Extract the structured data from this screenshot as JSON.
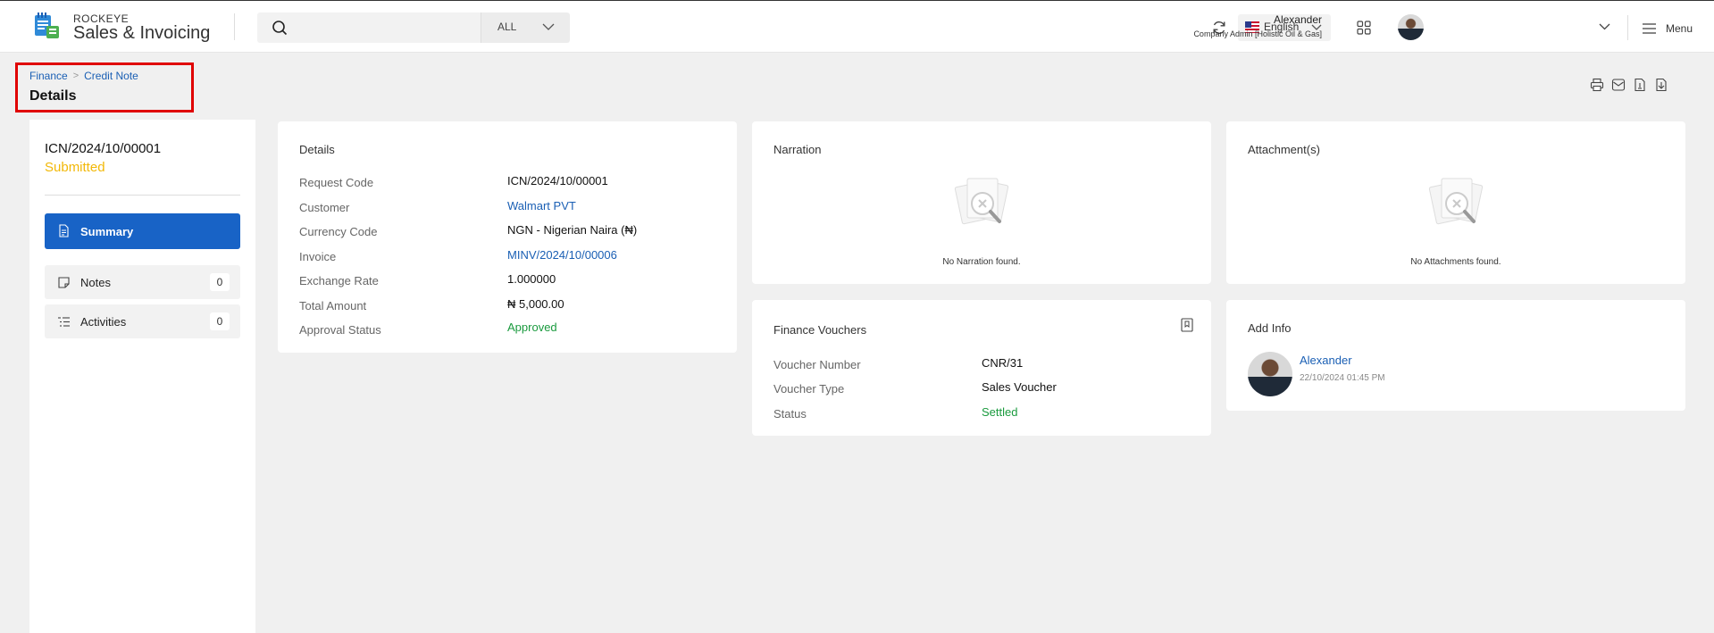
{
  "header": {
    "brand_top": "ROCKEYE",
    "brand_main": "Sales & Invoicing",
    "search_placeholder": "",
    "scope": "ALL",
    "language": "English",
    "user_name": "Alexander",
    "user_role": "Company Admin [Holistic Oil & Gas]",
    "menu_label": "Menu"
  },
  "breadcrumb": {
    "items": [
      "Finance",
      "Credit Note"
    ],
    "separator": ">"
  },
  "page_title": "Details",
  "record": {
    "code": "ICN/2024/10/00001",
    "status": "Submitted"
  },
  "nav": {
    "summary": "Summary",
    "notes": "Notes",
    "notes_count": "0",
    "activities": "Activities",
    "activities_count": "0"
  },
  "details": {
    "title": "Details",
    "labels": {
      "request_code": "Request Code",
      "customer": "Customer",
      "currency_code": "Currency Code",
      "invoice": "Invoice",
      "exchange_rate": "Exchange Rate",
      "total_amount": "Total Amount",
      "approval_status": "Approval Status"
    },
    "values": {
      "request_code": "ICN/2024/10/00001",
      "customer": "Walmart PVT",
      "currency_code": "NGN - Nigerian Naira (₦)",
      "invoice": "MINV/2024/10/00006",
      "exchange_rate": "1.000000",
      "total_amount": "₦ 5,000.00",
      "approval_status": "Approved"
    }
  },
  "narration": {
    "title": "Narration",
    "empty": "No Narration found."
  },
  "attachments": {
    "title": "Attachment(s)",
    "empty": "No Attachments found."
  },
  "vouchers": {
    "title": "Finance Vouchers",
    "labels": {
      "number": "Voucher Number",
      "type": "Voucher Type",
      "status": "Status"
    },
    "values": {
      "number": "CNR/31",
      "type": "Sales Voucher",
      "status": "Settled"
    }
  },
  "add_info": {
    "title": "Add Info",
    "name": "Alexander",
    "date": "22/10/2024 01:45 PM"
  },
  "colors": {
    "primary": "#1863c6",
    "link": "#1a5fb4",
    "submitted": "#f2b807",
    "success": "#1a9a3e",
    "highlight": "#e00000"
  }
}
